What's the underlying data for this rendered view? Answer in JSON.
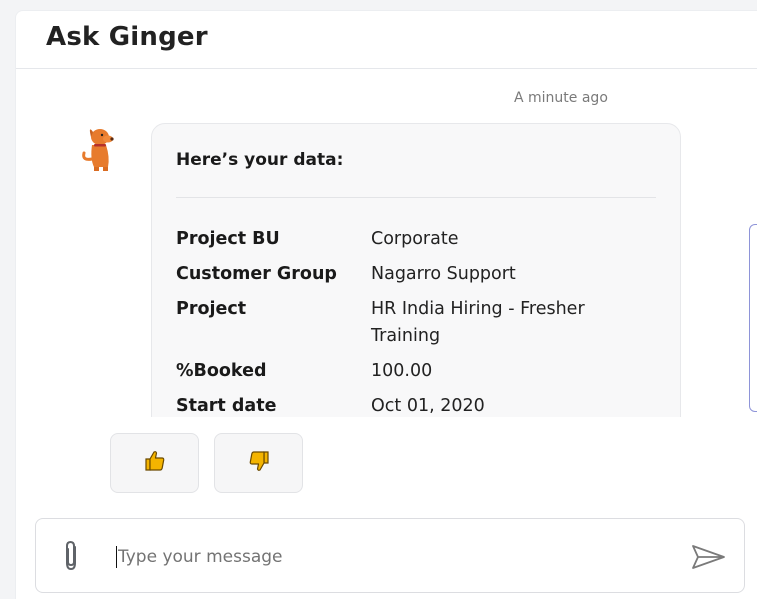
{
  "header": {
    "title": "Ask Ginger"
  },
  "chat": {
    "timestamp": "A minute ago",
    "message": {
      "heading": "Here’s your data:",
      "rows": [
        {
          "label": "Project BU",
          "value": "Corporate"
        },
        {
          "label": "Customer Group",
          "value": "Nagarro Support"
        },
        {
          "label": "Project",
          "value": "HR India Hiring - Fresher Training"
        },
        {
          "label": "%Booked",
          "value": "100.00"
        },
        {
          "label": "Start date",
          "value": "Oct 01, 2020"
        }
      ]
    },
    "feedback": {
      "thumbs_up_icon": "thumbs-up-icon",
      "thumbs_down_icon": "thumbs-down-icon"
    }
  },
  "composer": {
    "placeholder": "Type your message",
    "value": "",
    "attach_icon": "paperclip-icon",
    "send_icon": "send-icon"
  },
  "colors": {
    "accent_orange": "#e77b2d",
    "thumb_yellow": "#f4b400",
    "side_border": "#8e94d8"
  }
}
